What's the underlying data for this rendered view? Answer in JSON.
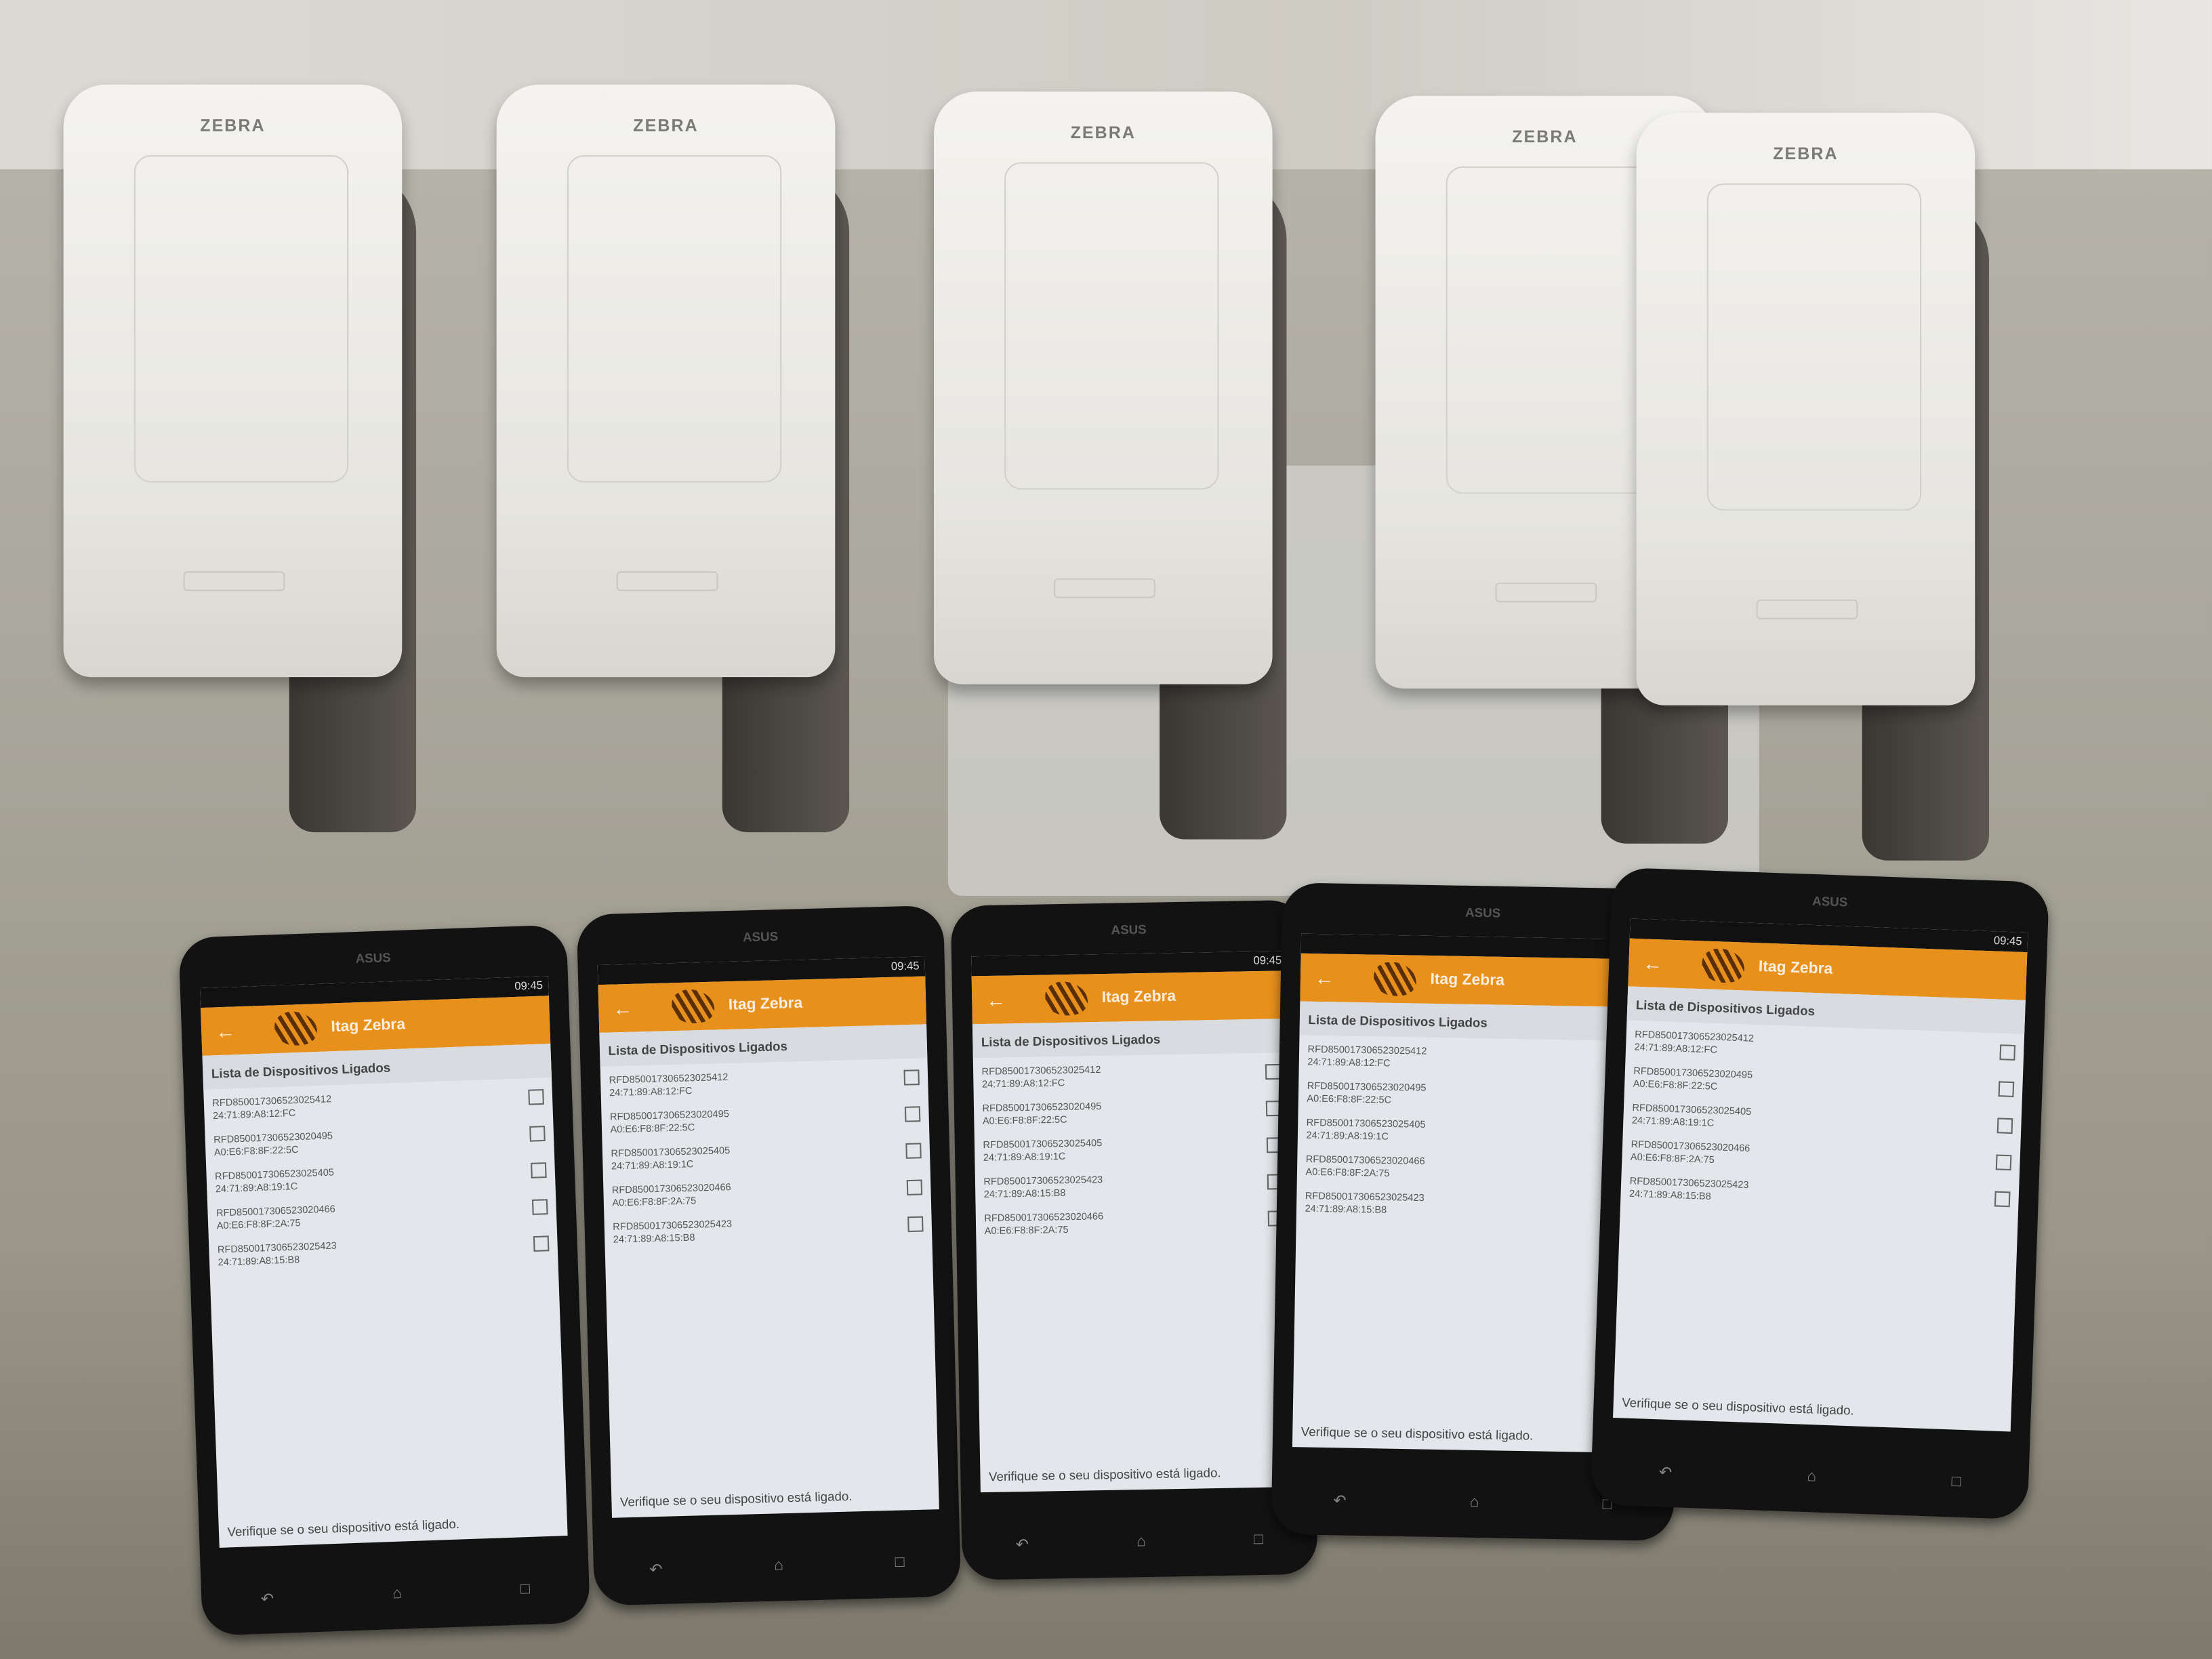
{
  "readers": [
    {
      "brand": "ZEBRA"
    },
    {
      "brand": "ZEBRA"
    },
    {
      "brand": "ZEBRA"
    },
    {
      "brand": "ZEBRA"
    },
    {
      "brand": "ZEBRA"
    }
  ],
  "app": {
    "title": "Itag Zebra",
    "section_title": "Lista de Dispositivos Ligados",
    "footer": "Verifique se o seu dispositivo está ligado.",
    "time": "09:45",
    "phone_brand": "ASUS",
    "colors": {
      "accent": "#e8901c",
      "background": "#e3e6ea"
    }
  },
  "devices": {
    "d25412": {
      "id": "RFD850017306523025412",
      "mac": "24:71:89:A8:12:FC"
    },
    "d20495": {
      "id": "RFD850017306523020495",
      "mac": "A0:E6:F8:8F:22:5C"
    },
    "d25405": {
      "id": "RFD850017306523025405",
      "mac": "24:71:89:A8:19:1C"
    },
    "d20466": {
      "id": "RFD850017306523020466",
      "mac": "A0:E6:F8:8F:2A:75"
    },
    "d25423": {
      "id": "RFD850017306523025423",
      "mac": "24:71:89:A8:15:B8"
    }
  },
  "phones": [
    {
      "list": [
        {
          "id": "RFD850017306523025412",
          "mac": "24:71:89:A8:12:FC",
          "checked": false
        },
        {
          "id": "RFD850017306523020495",
          "mac": "A0:E6:F8:8F:22:5C",
          "checked": false
        },
        {
          "id": "RFD850017306523025405",
          "mac": "24:71:89:A8:19:1C",
          "checked": false
        },
        {
          "id": "RFD850017306523020466",
          "mac": "A0:E6:F8:8F:2A:75",
          "checked": false
        },
        {
          "id": "RFD850017306523025423",
          "mac": "24:71:89:A8:15:B8",
          "checked": false
        }
      ]
    },
    {
      "list": [
        {
          "id": "RFD850017306523025412",
          "mac": "24:71:89:A8:12:FC",
          "checked": false
        },
        {
          "id": "RFD850017306523020495",
          "mac": "A0:E6:F8:8F:22:5C",
          "checked": false
        },
        {
          "id": "RFD850017306523025405",
          "mac": "24:71:89:A8:19:1C",
          "checked": false
        },
        {
          "id": "RFD850017306523020466",
          "mac": "A0:E6:F8:8F:2A:75",
          "checked": false
        },
        {
          "id": "RFD850017306523025423",
          "mac": "24:71:89:A8:15:B8",
          "checked": false
        }
      ]
    },
    {
      "list": [
        {
          "id": "RFD850017306523025412",
          "mac": "24:71:89:A8:12:FC",
          "checked": false
        },
        {
          "id": "RFD850017306523020495",
          "mac": "A0:E6:F8:8F:22:5C",
          "checked": false
        },
        {
          "id": "RFD850017306523025405",
          "mac": "24:71:89:A8:19:1C",
          "checked": false
        },
        {
          "id": "RFD850017306523025423",
          "mac": "24:71:89:A8:15:B8",
          "checked": false
        },
        {
          "id": "RFD850017306523020466",
          "mac": "A0:E6:F8:8F:2A:75",
          "checked": false
        }
      ]
    },
    {
      "list": [
        {
          "id": "RFD850017306523025412",
          "mac": "24:71:89:A8:12:FC",
          "checked": false
        },
        {
          "id": "RFD850017306523020495",
          "mac": "A0:E6:F8:8F:22:5C",
          "checked": false
        },
        {
          "id": "RFD850017306523025405",
          "mac": "24:71:89:A8:19:1C",
          "checked": false
        },
        {
          "id": "RFD850017306523020466",
          "mac": "A0:E6:F8:8F:2A:75",
          "checked": false
        },
        {
          "id": "RFD850017306523025423",
          "mac": "24:71:89:A8:15:B8",
          "checked": false
        }
      ]
    },
    {
      "list": [
        {
          "id": "RFD850017306523025412",
          "mac": "24:71:89:A8:12:FC",
          "checked": false
        },
        {
          "id": "RFD850017306523020495",
          "mac": "A0:E6:F8:8F:22:5C",
          "checked": false
        },
        {
          "id": "RFD850017306523025405",
          "mac": "24:71:89:A8:19:1C",
          "checked": false
        },
        {
          "id": "RFD850017306523020466",
          "mac": "A0:E6:F8:8F:2A:75",
          "checked": false
        },
        {
          "id": "RFD850017306523025423",
          "mac": "24:71:89:A8:15:B8",
          "checked": false
        }
      ]
    }
  ]
}
